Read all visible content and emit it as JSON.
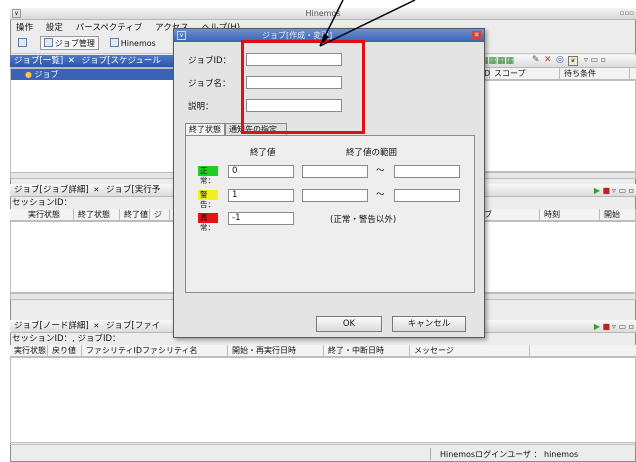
{
  "window": {
    "title": "Hinemos"
  },
  "menu": [
    "操作",
    "設定",
    "パースペクティブ",
    "アクセス",
    "ヘルプ(H)"
  ],
  "toolbar": {
    "perspective_label": "ジョブ管理",
    "second_label": "Hinemos"
  },
  "job_list_panel": {
    "tab_title": "ジョブ[一覧]",
    "tab2_title": "ジョブ[スケジュール",
    "tree_root": "ジョブ",
    "columns": [
      "D",
      "スコープ",
      "待ち条件"
    ]
  },
  "job_detail_panel": {
    "tab_title": "ジョブ[ジョブ詳細]",
    "tab2_title": "ジョブ[実行予",
    "session_label": "セッションID：",
    "columns": [
      "実行状態",
      "終了状態",
      "終了値",
      "ジ"
    ],
    "right_columns": [
      "ブ",
      "時刻",
      "開始"
    ]
  },
  "node_detail_panel": {
    "tab_title": "ジョブ[ノード詳細]",
    "tab2_title": "ジョブ[ファイ",
    "session_label": "セッションID：,  ジョブID：",
    "columns": [
      "実行状態",
      "戻り値",
      "ファシリティID",
      "ファシリティ名",
      "開始・再実行日時",
      "終了・中断日時",
      "メッセージ"
    ]
  },
  "status_bar": {
    "text": "Hinemosログインユーザ ： hinemos"
  },
  "dialog": {
    "title": "ジョブ[作成・変更]",
    "labels": {
      "job_id": "ジョブID：",
      "job_name": "ジョブ名：",
      "description": "説明："
    },
    "values": {
      "job_id": "",
      "job_name": "",
      "description": ""
    },
    "tabs": [
      "終了状態",
      "通知先の指定"
    ],
    "end_value_header": "終了値",
    "range_header": "終了値の範囲",
    "rows": [
      {
        "badge": "正常：",
        "color": "#22cc22",
        "value": "0",
        "range_from": "",
        "range_to": "",
        "has_range": true
      },
      {
        "badge": "警告：",
        "color": "#f2ee22",
        "value": "1",
        "range_from": "",
        "range_to": "",
        "has_range": true
      },
      {
        "badge": "異常：",
        "color": "#ee1111",
        "value": "-1",
        "note": "(正常・警告以外)",
        "has_range": false
      }
    ],
    "tilde": "～",
    "ok_label": "OK",
    "cancel_label": "キャンセル"
  }
}
